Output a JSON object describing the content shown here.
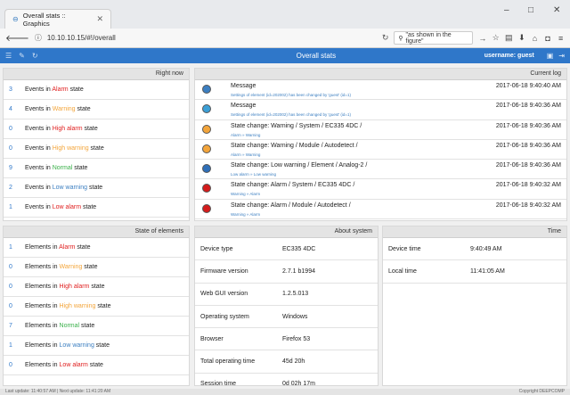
{
  "browser": {
    "tab_title": "Overall stats :: Graphics",
    "tab_close": "✕",
    "url": "10.10.10.15/#!/overall",
    "search": "\"as shown in the figure\"",
    "minimize": "–",
    "maximize": "□",
    "close": "✕"
  },
  "app": {
    "title": "Overall stats",
    "user": "username: guest"
  },
  "right_now": {
    "header": "Right now",
    "rows": [
      {
        "count": "3",
        "pre": "Events in ",
        "state": "Alarm",
        "post": " state",
        "cls": "c-alarm"
      },
      {
        "count": "4",
        "pre": "Events in ",
        "state": "Warning",
        "post": " state",
        "cls": "c-warning"
      },
      {
        "count": "0",
        "pre": "Events in ",
        "state": "High alarm",
        "post": " state",
        "cls": "c-highalarm"
      },
      {
        "count": "0",
        "pre": "Events in ",
        "state": "High warning",
        "post": " state",
        "cls": "c-highwarning"
      },
      {
        "count": "9",
        "pre": "Events in ",
        "state": "Normal",
        "post": " state",
        "cls": "c-normal"
      },
      {
        "count": "2",
        "pre": "Events in ",
        "state": "Low warning",
        "post": " state",
        "cls": "c-lowwarning"
      },
      {
        "count": "1",
        "pre": "Events in ",
        "state": "Low alarm",
        "post": " state",
        "cls": "c-lowalarm"
      }
    ]
  },
  "current_log": {
    "header": "Current log",
    "rows": [
      {
        "color": "#3c7fc1",
        "title": "Message",
        "sub": "Settings of element (id=202002) has been changed by 'guest' (id=1)",
        "time": "2017-06-18 9:40:40 AM"
      },
      {
        "color": "#3c9fd6",
        "title": "Message",
        "sub": "Settings of element (id=202002) has been changed by 'guest' (id=1)",
        "time": "2017-06-18 9:40:36 AM"
      },
      {
        "color": "#f3a53b",
        "title": "State change: Warning / System / EC335 4DC /",
        "sub": "Alarm » Warning",
        "time": "2017-06-18 9:40:36 AM"
      },
      {
        "color": "#f3a53b",
        "title": "State change: Warning / Module / Autodetect /",
        "sub": "Alarm » Warning",
        "time": "2017-06-18 9:40:36 AM"
      },
      {
        "color": "#2f6fb8",
        "title": "State change: Low warning / Element / Analog-2 /",
        "sub": "Low alarm » Low warning",
        "time": "2017-06-18 9:40:36 AM"
      },
      {
        "color": "#d41c1c",
        "title": "State change: Alarm / System / EC335 4DC /",
        "sub": "Warning » Alarm",
        "time": "2017-06-18 9:40:32 AM"
      },
      {
        "color": "#d41c1c",
        "title": "State change: Alarm / Module / Autodetect /",
        "sub": "Warning » Alarm",
        "time": "2017-06-18 9:40:32 AM"
      }
    ]
  },
  "state_of_elements": {
    "header": "State of elements",
    "rows": [
      {
        "count": "1",
        "pre": "Elements in ",
        "state": "Alarm",
        "post": " state",
        "cls": "c-alarm"
      },
      {
        "count": "0",
        "pre": "Elements in ",
        "state": "Warning",
        "post": " state",
        "cls": "c-warning"
      },
      {
        "count": "0",
        "pre": "Elements in ",
        "state": "High alarm",
        "post": " state",
        "cls": "c-highalarm"
      },
      {
        "count": "0",
        "pre": "Elements in ",
        "state": "High warning",
        "post": " state",
        "cls": "c-highwarning"
      },
      {
        "count": "7",
        "pre": "Elements in ",
        "state": "Normal",
        "post": " state",
        "cls": "c-normal"
      },
      {
        "count": "1",
        "pre": "Elements in ",
        "state": "Low warning",
        "post": " state",
        "cls": "c-lowwarning"
      },
      {
        "count": "0",
        "pre": "Elements in ",
        "state": "Low alarm",
        "post": " state",
        "cls": "c-lowalarm"
      }
    ]
  },
  "about_system": {
    "header": "About system",
    "rows": [
      {
        "key": "Device type",
        "value": "EC335 4DC"
      },
      {
        "key": "Firmware version",
        "value": "2.7.1 b1994"
      },
      {
        "key": "Web GUI version",
        "value": "1.2.5.013"
      },
      {
        "key": "Operating system",
        "value": "Windows"
      },
      {
        "key": "Browser",
        "value": "Firefox 53"
      },
      {
        "key": "Total operating time",
        "value": "45d 20h"
      },
      {
        "key": "Session time",
        "value": "0d 02h 17m"
      }
    ]
  },
  "time_panel": {
    "header": "Time",
    "rows": [
      {
        "key": "Device time",
        "value": "9:40:49 AM"
      },
      {
        "key": "Local time",
        "value": "11:41:05 AM"
      }
    ]
  },
  "statusbar": {
    "left": "Last update: 11:40:57 AM  |  Next update: 11:41:20 AM",
    "right": "Copyright DEEPCOMP"
  }
}
